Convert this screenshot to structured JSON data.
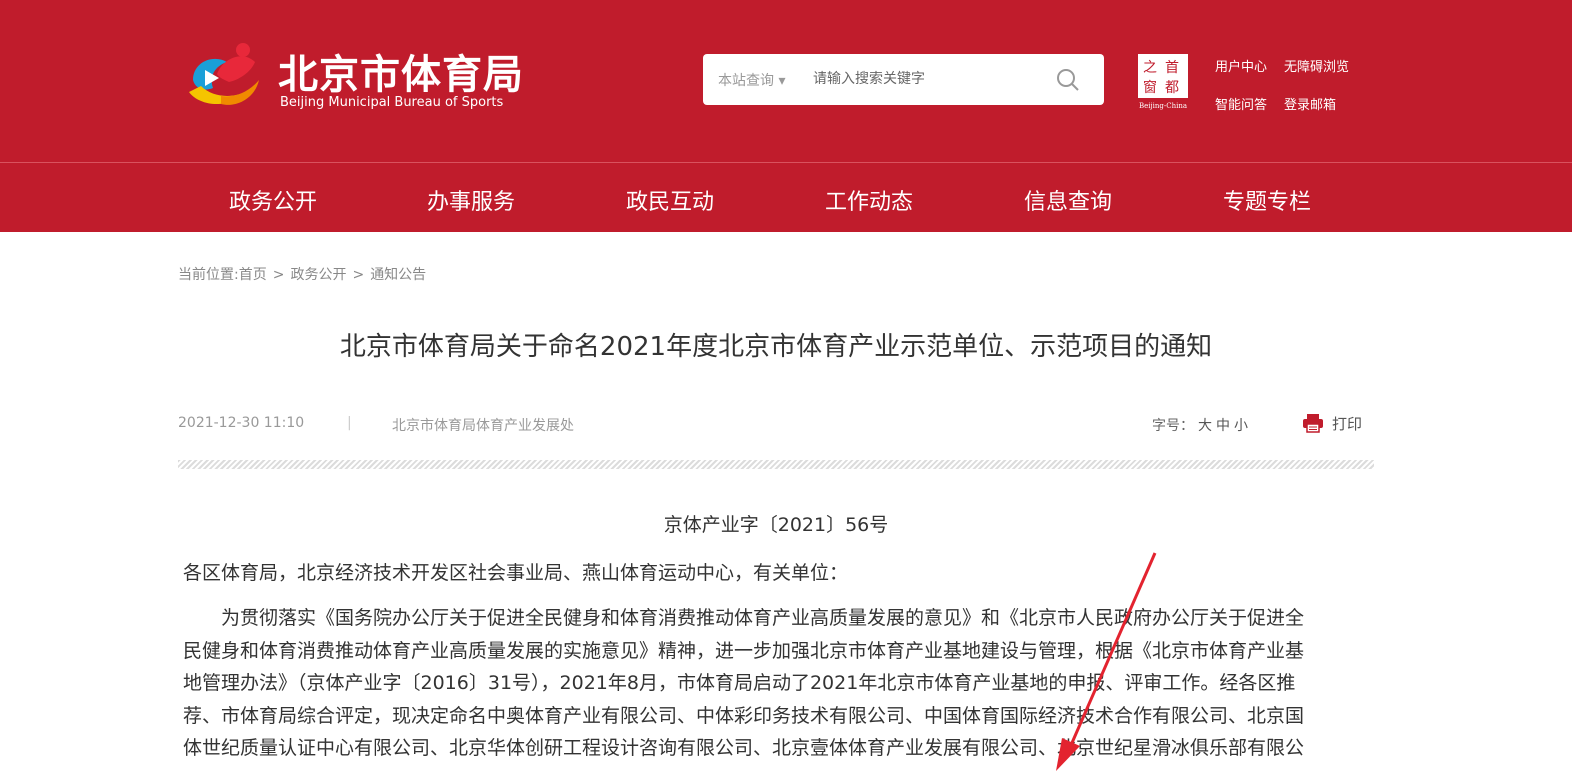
{
  "header": {
    "logo_cn": "北京市体育局",
    "logo_en": "Beijing Municipal Bureau of Sports",
    "search": {
      "scope_label": "本站查询",
      "placeholder": "请输入搜索关键字",
      "icon": "search-icon"
    },
    "capital_logo_text": "Beijing-China",
    "links": [
      "用户中心",
      "无障碍浏览",
      "智能问答",
      "登录邮箱"
    ]
  },
  "nav": {
    "items": [
      "政务公开",
      "办事服务",
      "政民互动",
      "工作动态",
      "信息查询",
      "专题专栏"
    ]
  },
  "breadcrumb": {
    "prefix": "当前位置:",
    "items": [
      "首页",
      "政务公开",
      "通知公告"
    ],
    "separator": ">"
  },
  "article": {
    "title": "北京市体育局关于命名2021年度北京市体育产业示范单位、示范项目的通知",
    "date": "2021-12-30 11:10",
    "meta_separator": "|",
    "source": "北京市体育局体育产业发展处",
    "font_size_label": "字号：",
    "font_size_options": [
      "大",
      "中",
      "小"
    ],
    "print_label": "打印",
    "doc_number": "京体产业字〔2021〕56号",
    "salutation": "各区体育局，北京经济技术开发区社会事业局、燕山体育运动中心，有关单位：",
    "body_lines": [
      "　　为贯彻落实《国务院办公厅关于促进全民健身和体育消费推动体育产业高质量发展的意见》和《北京市人民政府办公厅关于促进全",
      "民健身和体育消费推动体育产业高质量发展的实施意见》精神，进一步加强北京市体育产业基地建设与管理，根据《北京市体育产业基",
      "地管理办法》（京体产业字〔2016〕31号），2021年8月，市体育局启动了2021年北京市体育产业基地的申报、评审工作。经各区推",
      "荐、市体育局综合评定，现决定命名中奥体育产业有限公司、中体彩印务技术有限公司、中国体育国际经济技术合作有限公司、北京国",
      "体世纪质量认证中心有限公司、北京华体创研工程设计咨询有限公司、北京壹体体育产业发展有限公司、北京世纪星滑冰俱乐部有限公"
    ]
  },
  "colors": {
    "brand_red": "#c01c2c",
    "annotation_arrow": "#e3232f"
  }
}
